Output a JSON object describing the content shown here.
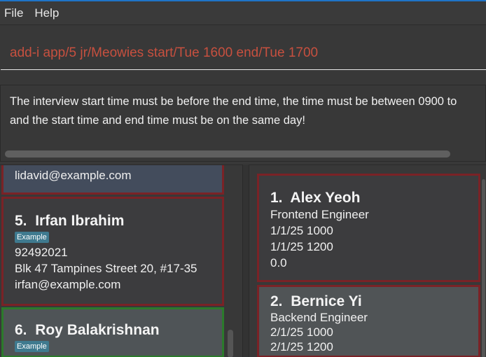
{
  "menu": {
    "file": "File",
    "help": "Help"
  },
  "command": {
    "value": "add-i app/5 jr/Meowies start/Tue 1600 end/Tue 1700"
  },
  "result": {
    "line1": "The interview start time must be before the end time, the time must be between 0900 to",
    "line2": "and the start time and end time must be on the same day!"
  },
  "persons": [
    {
      "email": "lidavid@example.com"
    },
    {
      "index": "5.",
      "name": "Irfan Ibrahim",
      "tag": "Example",
      "phone": "92492021",
      "address": "Blk 47 Tampines Street 20, #17-35",
      "email": "irfan@example.com"
    },
    {
      "index": "6.",
      "name": "Roy Balakrishnan",
      "tag": "Example"
    }
  ],
  "interviews": [
    {
      "index": "1.",
      "name": "Alex Yeoh",
      "role": "Frontend Engineer",
      "start": "1/1/25 1000",
      "end": "1/1/25 1200",
      "score": "0.0"
    },
    {
      "index": "2.",
      "name": "Bernice Yi",
      "role": "Backend Engineer",
      "start": "2/1/25 1000",
      "end": "2/1/25 1200"
    }
  ]
}
